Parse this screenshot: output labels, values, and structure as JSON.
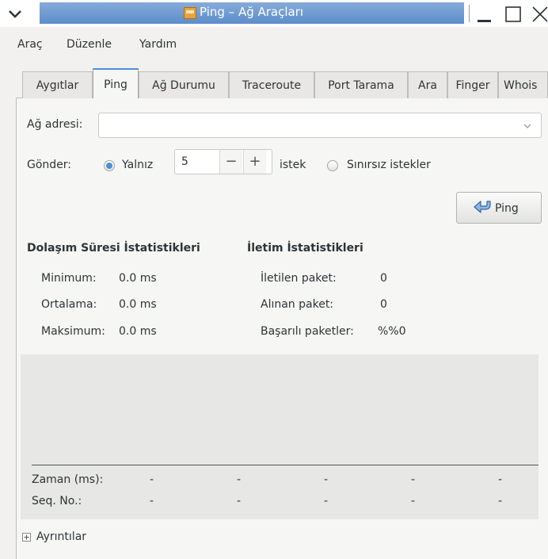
{
  "window": {
    "title": "Ping – Ağ Araçları",
    "accent": "#4a90d9",
    "icons": [
      "menu-chevron-icon",
      "app-icon",
      "minimize-icon",
      "maximize-icon",
      "close-icon"
    ]
  },
  "menubar": {
    "items": [
      "Araç",
      "Düzenle",
      "Yardım"
    ]
  },
  "tabs": [
    {
      "label": "Aygıtlar",
      "active": false
    },
    {
      "label": "Ping",
      "active": true
    },
    {
      "label": "Ağ Durumu",
      "active": false
    },
    {
      "label": "Traceroute",
      "active": false
    },
    {
      "label": "Port Tarama",
      "active": false
    },
    {
      "label": "Ara",
      "active": false
    },
    {
      "label": "Finger",
      "active": false
    },
    {
      "label": "Whois",
      "active": false
    }
  ],
  "form": {
    "address_label": "Ağ adresi:",
    "address_value": "",
    "send_label": "Gönder:",
    "only_label": "Yalnız",
    "count_value": "5",
    "request_label": "istek",
    "unlimited_label": "Sınırsız istekler",
    "mode_selected": "only",
    "ping_button": "Ping"
  },
  "round_trip": {
    "heading": "Dolaşım Süresi İstatistikleri",
    "min_label": "Minimum:",
    "min_value": "0.0 ms",
    "avg_label": "Ortalama:",
    "avg_value": "0.0 ms",
    "max_label": "Maksimum:",
    "max_value": "0.0 ms"
  },
  "transmission": {
    "heading": "İletim İstatistikleri",
    "sent_label": "İletilen paket:",
    "sent_value": "0",
    "received_label": "Alınan paket:",
    "received_value": "0",
    "success_label": "Başarılı paketler:",
    "success_value": "%%0"
  },
  "graph": {
    "time_label": "Zaman (ms):",
    "seq_label": "Seq. No.:",
    "time_values": [
      "-",
      "-",
      "-",
      "-",
      "-"
    ],
    "seq_values": [
      "-",
      "-",
      "-",
      "-",
      "-"
    ]
  },
  "details": {
    "label": "Ayrıntılar",
    "expanded": false
  }
}
